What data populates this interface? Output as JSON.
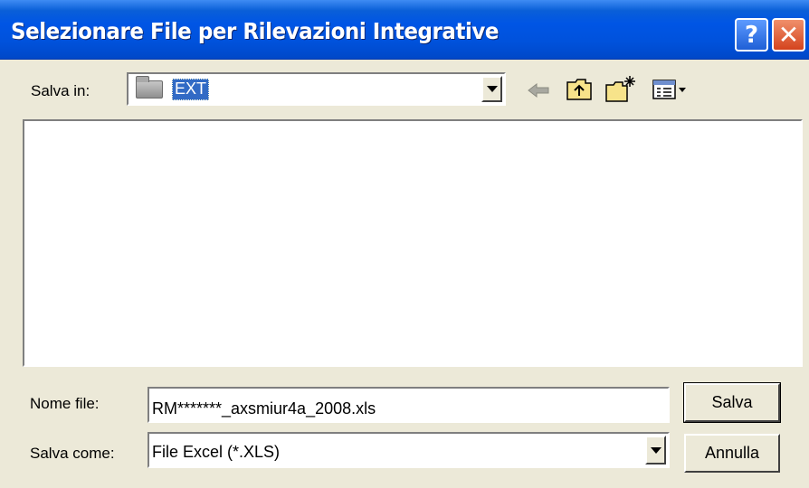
{
  "window": {
    "title": "Selezionare File per Rilevazioni Integrative",
    "help_glyph": "?",
    "close_glyph": "✕"
  },
  "save_in": {
    "label": "Salva in:",
    "folder": "EXT"
  },
  "toolbar": {
    "icons": [
      "back-arrow-icon",
      "up-folder-icon",
      "new-folder-icon",
      "views-menu-icon"
    ]
  },
  "file_name": {
    "label": "Nome file:",
    "value": "RM*******_axsmiur4a_2008.xls"
  },
  "save_as": {
    "label": "Salva come:",
    "value": "File Excel (*.XLS)"
  },
  "buttons": {
    "save": "Salva",
    "cancel": "Annulla"
  },
  "colors": {
    "titlebar": "#0055e5",
    "selection": "#316ac5",
    "dialog_bg": "#ece9d8",
    "close_button": "#d4431d"
  }
}
